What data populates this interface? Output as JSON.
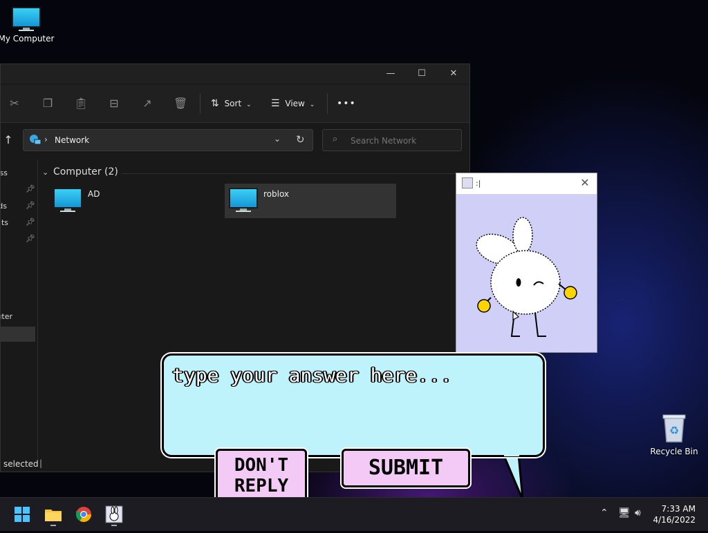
{
  "desktop": {
    "icons": [
      {
        "label": "My Computer"
      },
      {
        "label": "Recycle Bin"
      }
    ]
  },
  "explorer": {
    "toolbar": {
      "sort_label": "Sort",
      "view_label": "View",
      "more_label": "•••"
    },
    "address": {
      "location": "Network"
    },
    "search": {
      "placeholder": "Search Network"
    },
    "nav_items": [
      {
        "label": "ss"
      },
      {
        "label": ""
      },
      {
        "label": "ds"
      },
      {
        "label": "nts"
      },
      {
        "label": ""
      },
      {
        "label": "uter"
      }
    ],
    "group": {
      "header": "Computer (2)"
    },
    "items": [
      {
        "name": "AD"
      },
      {
        "name": "roblox"
      }
    ],
    "status": {
      "text": "selected"
    }
  },
  "popup": {
    "title": ":|"
  },
  "bubble": {
    "placeholder": "type your answer here...",
    "dont_reply_line1": "DON'T",
    "dont_reply_line2": "REPLY",
    "submit_label": "SUBMIT"
  },
  "taskbar": {
    "time": "7:33 AM",
    "date": "4/16/2022"
  },
  "colors": {
    "bubble": "#bff3fb",
    "button": "#f3c9f6",
    "popup_bg": "#cfcff8",
    "accent": "#4cc2ff"
  }
}
